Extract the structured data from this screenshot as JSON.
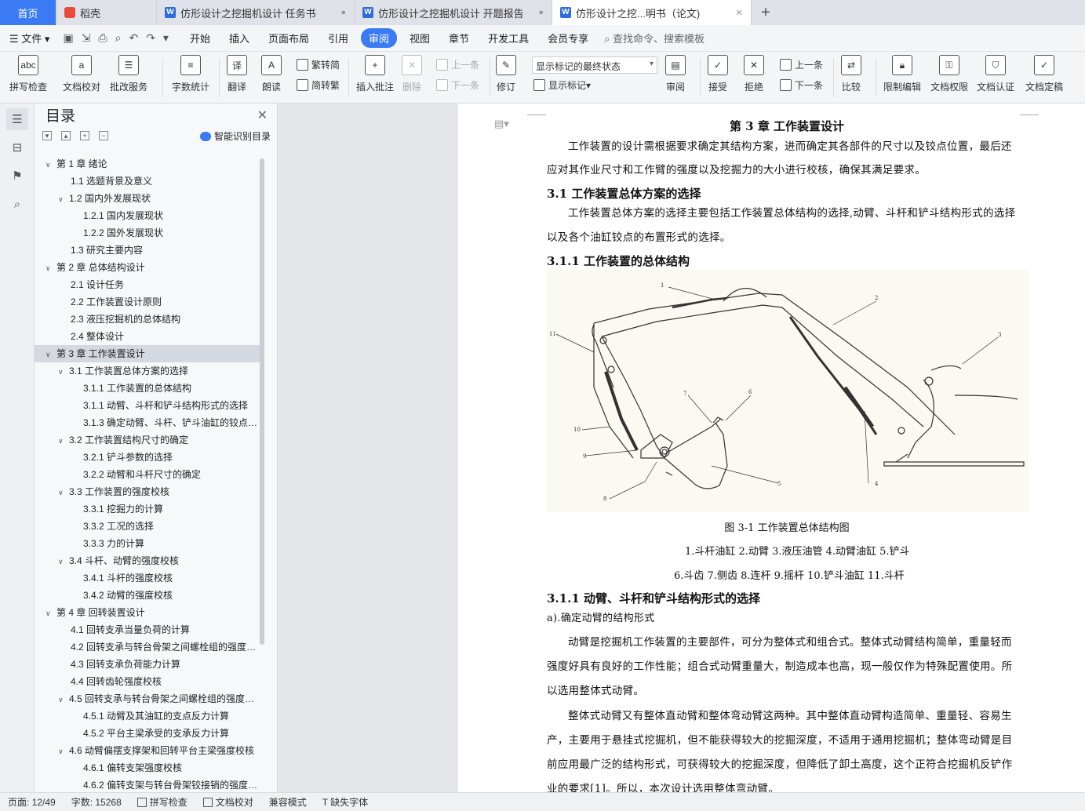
{
  "tabs": {
    "home": "首页",
    "docer": "稻壳",
    "t1": "仿形设计之挖掘机设计 任务书",
    "t2": "仿形设计之挖掘机设计 开题报告",
    "t3": "仿形设计之挖...明书（论文)"
  },
  "menu": {
    "file": "文件",
    "items": [
      "开始",
      "插入",
      "页面布局",
      "引用",
      "审阅",
      "视图",
      "章节",
      "开发工具",
      "会员专享"
    ],
    "active": "审阅",
    "search": "查找命令、搜索模板"
  },
  "ribbon": {
    "spell": "拼写检查",
    "doccheck": "文档校对",
    "batch": "批改服务",
    "wordcount": "字数统计",
    "translate": "翻译",
    "read": "朗读",
    "trad": "繁转简",
    "simp": "简转繁",
    "insert_comment": "插入批注",
    "delete": "删除",
    "prev": "上一条",
    "next": "下一条",
    "revise": "修订",
    "markup_mode": "显示标记的最终状态",
    "show_markup": "显示标记",
    "review": "审阅",
    "accept": "接受",
    "reject": "拒绝",
    "prev2": "上一条",
    "next2": "下一条",
    "compare": "比较",
    "restrict": "限制编辑",
    "perm": "文档权限",
    "auth": "文档认证",
    "final": "文档定稿"
  },
  "toc": {
    "title": "目录",
    "smart": "智能识别目录",
    "items": [
      {
        "t": "第 1 章  绪论",
        "lvl": 1,
        "arrow": true
      },
      {
        "t": "1.1 选题背景及意义",
        "lvl": 2
      },
      {
        "t": "1.2 国内外发展现状",
        "lvl": 2,
        "arrow": true
      },
      {
        "t": "1.2.1 国内发展现状",
        "lvl": 3
      },
      {
        "t": "1.2.2 国外发展现状",
        "lvl": 3
      },
      {
        "t": "1.3 研究主要内容",
        "lvl": 2
      },
      {
        "t": "第 2 章  总体结构设计",
        "lvl": 1,
        "arrow": true
      },
      {
        "t": "2.1 设计任务",
        "lvl": 2
      },
      {
        "t": "2.2 工作装置设计原则",
        "lvl": 2
      },
      {
        "t": "2.3 液压挖掘机的总体结构",
        "lvl": 2
      },
      {
        "t": "2.4 整体设计",
        "lvl": 2
      },
      {
        "t": "第 3 章  工作装置设计",
        "lvl": 1,
        "arrow": true,
        "sel": true
      },
      {
        "t": "3.1  工作装置总体方案的选择",
        "lvl": 2,
        "arrow": true
      },
      {
        "t": "3.1.1 工作装置的总体结构",
        "lvl": 3
      },
      {
        "t": "3.1.1 动臂、斗杆和铲斗结构形式的选择",
        "lvl": 3
      },
      {
        "t": "3.1.3 确定动臂、斗杆、铲斗油缸的铰点位置",
        "lvl": 3
      },
      {
        "t": "3.2 工作装置结构尺寸的确定",
        "lvl": 2,
        "arrow": true
      },
      {
        "t": "3.2.1 铲斗参数的选择",
        "lvl": 3
      },
      {
        "t": "3.2.2 动臂和斗杆尺寸的确定",
        "lvl": 3
      },
      {
        "t": "3.3 工作装置的强度校核",
        "lvl": 2,
        "arrow": true
      },
      {
        "t": "3.3.1 挖掘力的计算",
        "lvl": 3
      },
      {
        "t": "3.3.2 工况的选择",
        "lvl": 3
      },
      {
        "t": "3.3.3 力的计算",
        "lvl": 3
      },
      {
        "t": "3.4 斗杆、动臂的强度校核",
        "lvl": 2,
        "arrow": true
      },
      {
        "t": "3.4.1 斗杆的强度校核",
        "lvl": 3
      },
      {
        "t": "3.4.2 动臂的强度校核",
        "lvl": 3
      },
      {
        "t": "第 4 章  回转装置设计",
        "lvl": 1,
        "arrow": true
      },
      {
        "t": "4.1 回转支承当量负荷的计算",
        "lvl": 2
      },
      {
        "t": "4.2 回转支承与转台骨架之间螺栓组的强度校核",
        "lvl": 2
      },
      {
        "t": "4.3 回转支承负荷能力计算",
        "lvl": 2
      },
      {
        "t": "4.4 回转齿轮强度校核",
        "lvl": 2
      },
      {
        "t": "4.5  回转支承与转台骨架之间螺栓组的强度校核",
        "lvl": 2,
        "arrow": true
      },
      {
        "t": "4.5.1  动臂及其油缸的支点反力计算",
        "lvl": 3
      },
      {
        "t": "4.5.2  平台主梁承受的支承反力计算",
        "lvl": 3
      },
      {
        "t": "4.6 动臂偏摆支撑架和回转平台主梁强度校核",
        "lvl": 2,
        "arrow": true
      },
      {
        "t": "4.6.1  偏转支架强度校核",
        "lvl": 3
      },
      {
        "t": "4.6.2  偏转支架与转台骨架铰接销的强度校核",
        "lvl": 3
      }
    ]
  },
  "doc": {
    "chapter": "第 3 章  工作装置设计",
    "p1a": "工作装置的设计需根据要求确定其结构方案，进而确定其各部件的尺寸以及铰点位置，最后还",
    "p1b": "应对其作业尺寸和工作臂的强度以及挖掘力的大小进行校核，确保其满足要求。",
    "h31": "3.1  工作装置总体方案的选择",
    "p2a": "工作装置总体方案的选择主要包括工作装置总体结构的选择,动臂、斗杆和铲斗结构形式的选择",
    "p2b": "以及各个油缸铰点的布置形式的选择。",
    "h311": "3.1.1 工作装置的总体结构",
    "caption": "图 3-1  工作装置总体结构图",
    "leg1": "1.斗杆油缸    2.动臂    3.液压油管     4.动臂油缸     5.铲斗",
    "leg2": "6.斗齿    7.侧齿     8.连杆    9.摇杆     10.铲斗油缸     11.斗杆",
    "h312": "3.1.1 动臂、斗杆和铲斗结构形式的选择",
    "sub_a": "a).确定动臂的结构形式",
    "p3a": "动臂是挖掘机工作装置的主要部件，可分为整体式和组合式。整体式动臂结构简单，重量轻而",
    "p3b": "强度好具有良好的工作性能；组合式动臂重量大，制造成本也高，现一般仅作为特殊配置使用。所",
    "p3c": "以选用整体式动臂。",
    "p4a": "整体式动臂又有整体直动臂和整体弯动臂这两种。其中整体直动臂构造简单、重量轻、容易生",
    "p4b": "产，主要用于悬挂式挖掘机，但不能获得较大的挖掘深度，不适用于通用挖掘机；整体弯动臂是目",
    "p4c": "前应用最广泛的结构形式，可获得较大的挖掘深度，但降低了卸土高度，这个正符合挖掘机反铲作",
    "p4d": "业的要求[1]。所以，本次设计选用整体弯动臂。",
    "fig_labels": [
      "1",
      "2",
      "3",
      "4",
      "5",
      "6",
      "7",
      "8",
      "9",
      "10",
      "11"
    ]
  },
  "status": {
    "page": "页面: 12/49",
    "words": "字数: 15268",
    "spell": "拼写检查",
    "doccheck": "文档校对",
    "compat": "兼容模式",
    "font": "缺失字体"
  }
}
